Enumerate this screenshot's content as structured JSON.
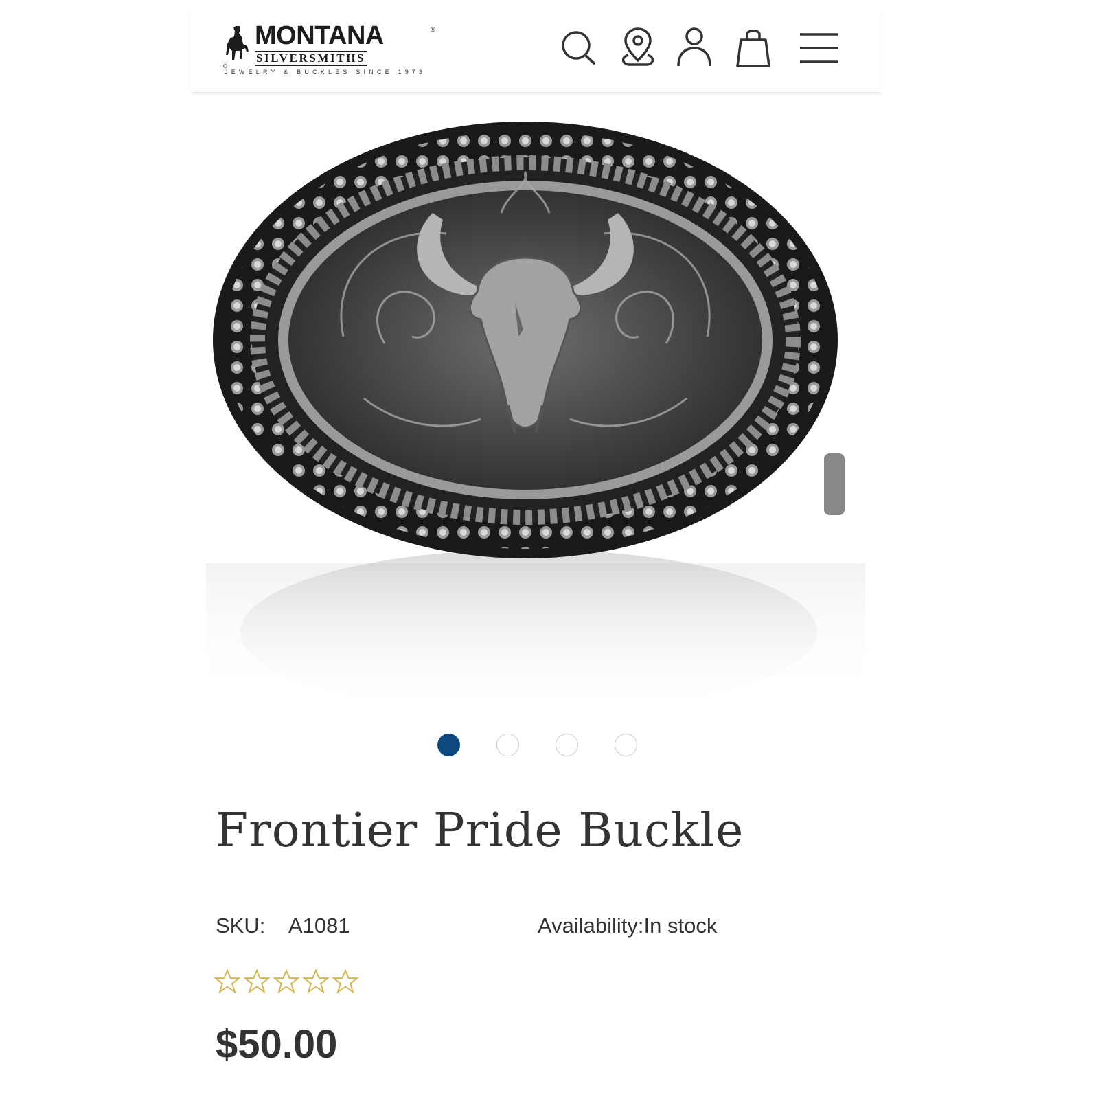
{
  "header": {
    "logo": {
      "main": "MONTANA",
      "registered": "®",
      "sub": "SILVERSMITHS",
      "tagline": "JEWELRY & BUCKLES SINCE 1973"
    },
    "icons": [
      "search-icon",
      "store-locator-icon",
      "account-icon",
      "cart-icon",
      "menu-icon"
    ]
  },
  "carousel": {
    "count": 4,
    "active_index": 0,
    "active_color": "#0e4a80"
  },
  "product": {
    "title": "Frontier Pride Buckle",
    "sku_label": "SKU:",
    "sku_value": "A1081",
    "availability": "Availability:In stock",
    "rating": 0,
    "max_rating": 5,
    "star_color": "#d4b44a",
    "price": "$50.00"
  }
}
